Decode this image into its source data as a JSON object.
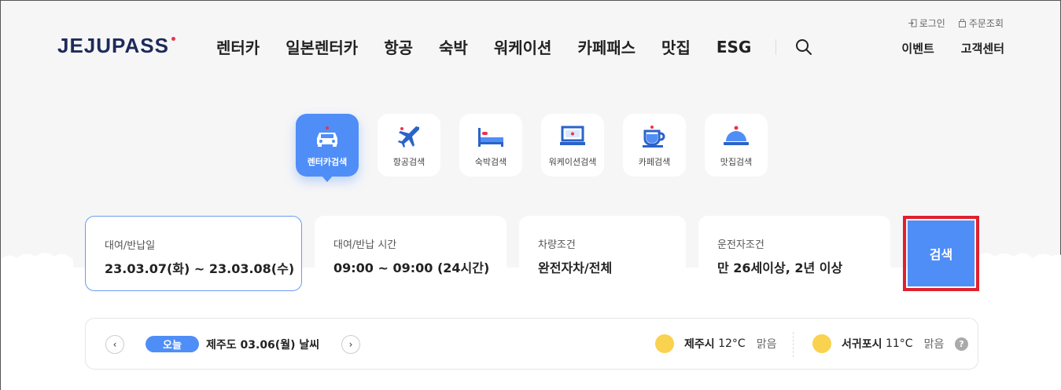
{
  "header": {
    "logo": "JEJUPASS",
    "nav": [
      "렌터카",
      "일본렌터카",
      "항공",
      "숙박",
      "워케이션",
      "카페패스",
      "맛집",
      "ESG"
    ],
    "util_top": {
      "login": "로그인",
      "order": "주문조회"
    },
    "util_bottom": {
      "event": "이벤트",
      "support": "고객센터"
    }
  },
  "tabs": [
    {
      "label": "렌터카검색",
      "icon": "car-icon",
      "active": true
    },
    {
      "label": "항공검색",
      "icon": "airplane-icon",
      "active": false
    },
    {
      "label": "숙박검색",
      "icon": "bed-icon",
      "active": false
    },
    {
      "label": "워케이션검색",
      "icon": "laptop-icon",
      "active": false
    },
    {
      "label": "카페검색",
      "icon": "coffee-cup-icon",
      "active": false
    },
    {
      "label": "맛집검색",
      "icon": "food-cloche-icon",
      "active": false
    }
  ],
  "search": {
    "dates": {
      "label": "대여/반납일",
      "value": "23.03.07(화) ~ 23.03.08(수)"
    },
    "times": {
      "label": "대여/반납 시간",
      "value": "09:00 ~ 09:00 (24시간)"
    },
    "vehicle": {
      "label": "차량조건",
      "value": "완전자차/전체"
    },
    "driver": {
      "label": "운전자조건",
      "value": "만 26세이상, 2년 이상"
    },
    "button": "검색"
  },
  "weather": {
    "today": "오늘",
    "title": "제주도 03.06(월) 날씨",
    "cities": [
      {
        "name": "제주시",
        "temp": "12°C",
        "cond": "맑음",
        "icon": "sun-icon"
      },
      {
        "name": "서귀포시",
        "temp": "11°C",
        "cond": "맑음",
        "icon": "sun-icon"
      }
    ]
  },
  "colors": {
    "accent": "#4f8ef7",
    "highlight_border": "#e0202e",
    "brand": "#1d2a5a"
  }
}
